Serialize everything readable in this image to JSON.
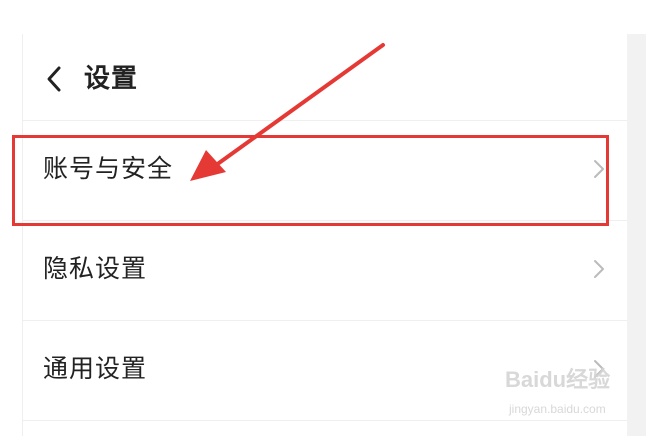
{
  "header": {
    "title": "设置",
    "back_icon": "chevron-left-icon"
  },
  "settings": {
    "items": [
      {
        "label": "账号与安全",
        "icon": "chevron-right-icon"
      },
      {
        "label": "隐私设置",
        "icon": "chevron-right-icon"
      },
      {
        "label": "通用设置",
        "icon": "chevron-right-icon"
      }
    ]
  },
  "annotation": {
    "highlight_color": "#e53935"
  },
  "watermark": {
    "main": "Baidu经验",
    "sub": "jingyan.baidu.com"
  }
}
